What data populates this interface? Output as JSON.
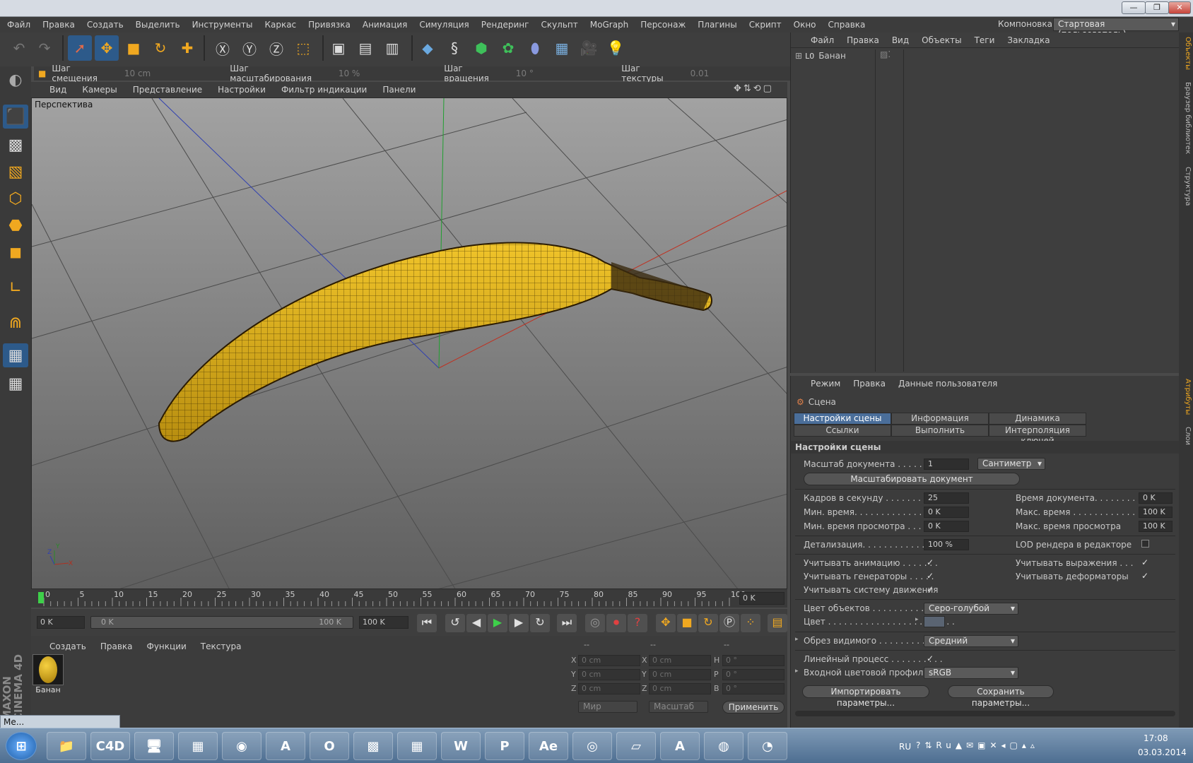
{
  "window": {
    "min": "—",
    "max": "❐",
    "close": "✕"
  },
  "menubar": [
    "Файл",
    "Правка",
    "Создать",
    "Выделить",
    "Инструменты",
    "Каркас",
    "Привязка",
    "Анимация",
    "Симуляция",
    "Рендеринг",
    "Скульпт",
    "MoGraph",
    "Персонаж",
    "Плагины",
    "Скрипт",
    "Окно",
    "Справка"
  ],
  "layout": {
    "label": "Компоновка",
    "value": "Стартовая (пользователь)"
  },
  "snapbar": {
    "move_label": "Шаг смещения",
    "move_value": "10 cm",
    "scale_label": "Шаг масштабирования",
    "scale_value": "10 %",
    "rotate_label": "Шаг вращения",
    "rotate_value": "10 °",
    "texture_label": "Шаг текстуры",
    "texture_value": "0.01"
  },
  "viewport_menu": [
    "Вид",
    "Камеры",
    "Представление",
    "Настройки",
    "Фильтр индикации",
    "Панели"
  ],
  "viewport_label": "Перспектива",
  "axis": {
    "x": "X",
    "y": "Y",
    "z": "Z"
  },
  "timeline": {
    "ticks": [
      "0",
      "5",
      "10",
      "15",
      "20",
      "25",
      "30",
      "35",
      "40",
      "45",
      "50",
      "55",
      "60",
      "65",
      "70",
      "75",
      "80",
      "85",
      "90",
      "95",
      "100"
    ],
    "frame_field": "0 K"
  },
  "transport": {
    "start": "0 K",
    "range_start": "0 K",
    "range_end": "100 K",
    "end": "100 K"
  },
  "material_menu": [
    "Создать",
    "Правка",
    "Функции",
    "Текстура"
  ],
  "material": {
    "name": "Банан"
  },
  "coords": {
    "headers": [
      "--",
      "--",
      "--"
    ],
    "row1": {
      "a": "X",
      "av": "0 cm",
      "b": "X",
      "bv": "0 cm",
      "c": "H",
      "cv": "0 °"
    },
    "row2": {
      "a": "Y",
      "av": "0 cm",
      "b": "Y",
      "bv": "0 cm",
      "c": "P",
      "cv": "0 °"
    },
    "row3": {
      "a": "Z",
      "av": "0 cm",
      "b": "Z",
      "bv": "0 cm",
      "c": "B",
      "cv": "0 °"
    },
    "world": "Мир",
    "scale": "Масштаб",
    "apply": "Применить"
  },
  "object_menu": [
    "Файл",
    "Правка",
    "Вид",
    "Объекты",
    "Теги",
    "Закладка"
  ],
  "object_tree": [
    {
      "icon": "L0",
      "name": "Банан"
    }
  ],
  "attr_menu": [
    "Режим",
    "Правка",
    "Данные пользователя"
  ],
  "attr": {
    "title": "Сцена",
    "tabs_row1": [
      "Настройки сцены",
      "Информация",
      "Динамика"
    ],
    "tabs_row2": [
      "Ссылки",
      "Выполнить",
      "Интерполяция ключей"
    ],
    "section": "Настройки сцены",
    "doc_scale_label": "Масштаб документа . . . . . . . .",
    "doc_scale_value": "1",
    "doc_scale_unit": "Сантиметр",
    "scale_doc_button": "Масштабировать документ",
    "fps_label": "Кадров в секунду . . . . . . . . . . .",
    "fps_value": "25",
    "min_time_label": "Мин. время. . . . . . . . . . . . . . . . .",
    "min_time_value": "0 K",
    "min_preview_label": "Мин. время просмотра . . . . . .",
    "min_preview_value": "0 K",
    "doc_time_label": "Время документа. . . . . . . . .",
    "doc_time_value": "0 K",
    "max_time_label": "Макс. время . . . . . . . . . . . . . .",
    "max_time_value": "100 K",
    "max_preview_label": "Макс. время просмотра",
    "max_preview_value": "100 K",
    "lod_label": "Детализация. . . . . . . . . . . . . . . .",
    "lod_value": "100 %",
    "lod_editor_label": "LOD рендера в редакторе",
    "use_anim_label": "Учитывать анимацию . . . . . . .",
    "use_gen_label": "Учитывать генераторы . . . . .",
    "use_motion_label": "Учитывать систему движения",
    "use_expr_label": "Учитывать выражения . . .",
    "use_deform_label": "Учитывать деформаторы",
    "check": "✓",
    "obj_color_label": "Цвет объектов . . . . . . . . . . . . . .",
    "obj_color_value": "Серо-голубой",
    "color_label": "Цвет . . . . . . . . . . . . . . . . . . . . . . . .",
    "clip_label": "Обрез видимого . . . . . . . . . . . .",
    "clip_value": "Средний",
    "linear_label": "Линейный процесс . . . . . . . . . .",
    "input_profile_label": "Входной цветовой профиль",
    "input_profile_value": "sRGB",
    "import_button": "Импортировать параметры...",
    "save_button": "Сохранить параметры..."
  },
  "sidetabs": [
    "Объекты",
    "Браузер библиотек",
    "Структура",
    "Атрибуты",
    "Слои"
  ],
  "maxon": "MAXON CINEMA 4D",
  "minimized_window": "Ме...",
  "taskbar": {
    "apps": [
      "⊞",
      "📁",
      "C4D",
      "🖥",
      "▦",
      "◉",
      "A",
      "O",
      "▩",
      "▦",
      "W",
      "P",
      "Ae",
      "◎",
      "▱",
      "A",
      "◍",
      "◔"
    ],
    "lang": "RU",
    "time": "17:08",
    "date": "03.03.2014"
  },
  "colors": {
    "accent": "#2d5a8a",
    "icon": "#f0a820",
    "banana": "#e2b21c"
  }
}
